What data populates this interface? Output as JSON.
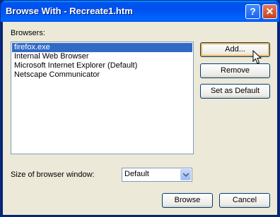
{
  "window": {
    "title": "Browse With - Recreate1.htm",
    "help_label": "?",
    "close_label": "✕"
  },
  "browsers_label": "Browsers:",
  "browsers": [
    {
      "label": "firefox.exe",
      "selected": true
    },
    {
      "label": "Internal Web Browser",
      "selected": false
    },
    {
      "label": "Microsoft Internet Explorer (Default)",
      "selected": false
    },
    {
      "label": "Netscape Communicator",
      "selected": false
    }
  ],
  "buttons": {
    "add": "Add...",
    "remove": "Remove",
    "set_default": "Set as Default",
    "browse": "Browse",
    "cancel": "Cancel"
  },
  "size_label": "Size of browser window:",
  "size_select": {
    "value": "Default"
  },
  "colors": {
    "titlebar": "#0054e3",
    "selection": "#316ac5",
    "dialog_bg": "#ece9d8"
  }
}
